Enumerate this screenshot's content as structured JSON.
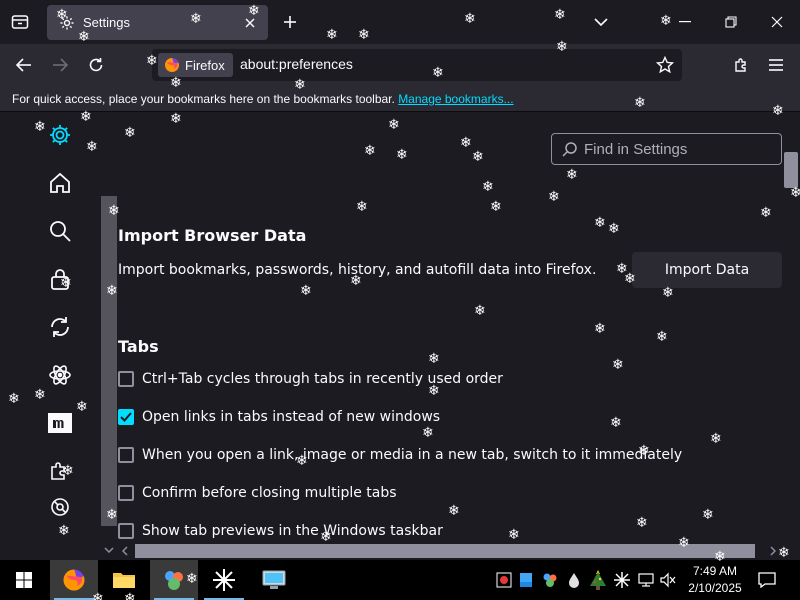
{
  "tabstrip": {
    "tab_title": "Settings"
  },
  "navbar": {
    "identity_label": "Firefox",
    "url": "about:preferences"
  },
  "bookmarks_bar": {
    "message": "For quick access, place your bookmarks here on the bookmarks toolbar. ",
    "link_label": "Manage bookmarks..."
  },
  "sidebar": {
    "categories": [
      {
        "icon": "gear-icon",
        "selected": true
      },
      {
        "icon": "home-icon"
      },
      {
        "icon": "search-icon"
      },
      {
        "icon": "lock-icon"
      },
      {
        "icon": "sync-icon"
      },
      {
        "icon": "atom-icon"
      },
      {
        "icon": "mozilla-icon",
        "text": "m"
      },
      {
        "icon": "extensions-puzzle-icon"
      },
      {
        "icon": "support-icon"
      }
    ]
  },
  "search": {
    "placeholder": "Find in Settings"
  },
  "import": {
    "title": "Import Browser Data",
    "description": "Import bookmarks, passwords, history, and autofill data into Firefox.",
    "button_label": "Import Data"
  },
  "tabs_section": {
    "title": "Tabs",
    "options": [
      {
        "label": "Ctrl+Tab cycles through tabs in recently used order",
        "checked": false
      },
      {
        "label": "Open links in tabs instead of new windows",
        "checked": true
      },
      {
        "label": "When you open a link, image or media in a new tab, switch to it immediately",
        "checked": false
      },
      {
        "label": "Confirm before closing multiple tabs",
        "checked": false
      },
      {
        "label": "Show tab previews in the Windows taskbar",
        "checked": false
      }
    ]
  },
  "taskbar": {
    "time": "7:49 AM",
    "date": "2/10/2025"
  },
  "colors": {
    "accent": "#00ddff",
    "background": "#1c1b22",
    "toolbar": "#2b2a33"
  }
}
